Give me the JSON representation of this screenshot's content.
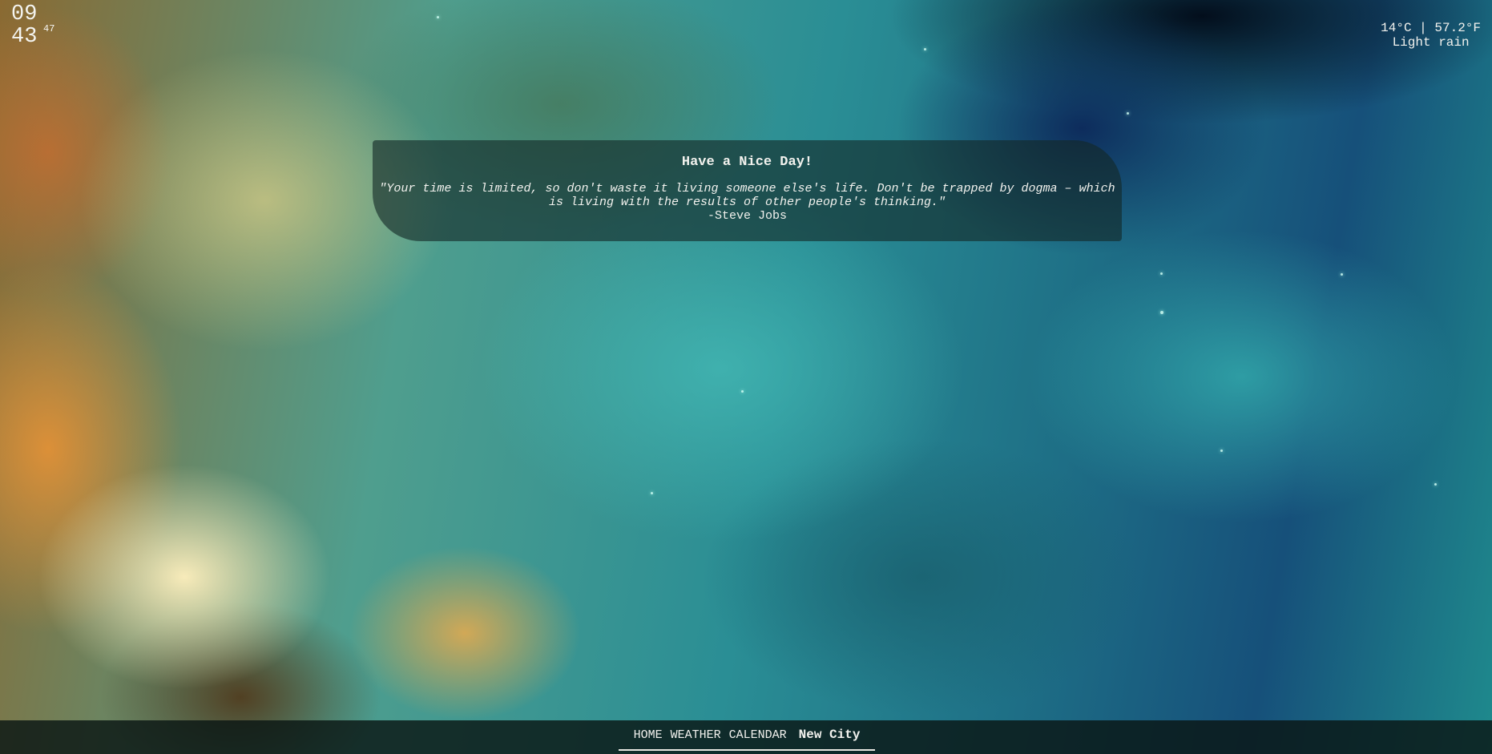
{
  "clock": {
    "hours": "09",
    "minutes": "43",
    "seconds": "47"
  },
  "weather": {
    "temperature": "14°C | 57.2°F",
    "condition": "Light rain"
  },
  "quote": {
    "title": "Have a Nice Day!",
    "text": "\"Your time is limited, so don't waste it living someone else's life. Don't be trapped by dogma – which is living with the results of other people's thinking.\"",
    "author": "-Steve Jobs"
  },
  "nav": {
    "items": [
      {
        "label": "HOME"
      },
      {
        "label": "WEATHER"
      },
      {
        "label": "CALENDAR"
      },
      {
        "label": "New City"
      }
    ]
  }
}
